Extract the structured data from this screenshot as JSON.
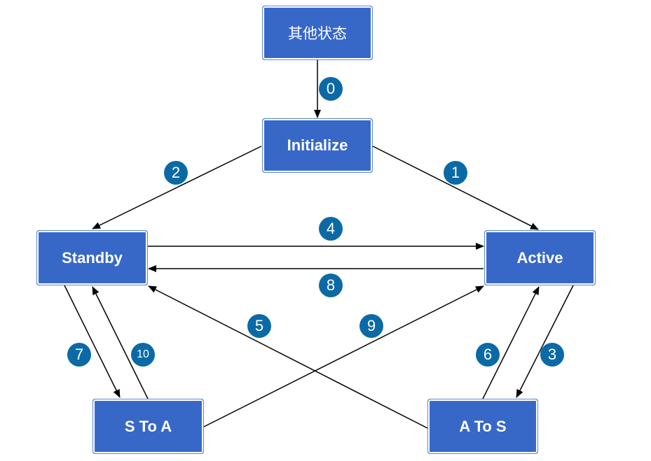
{
  "diagram": {
    "nodes": [
      {
        "id": "other",
        "label": "其他状态"
      },
      {
        "id": "init",
        "label": "Initialize"
      },
      {
        "id": "standby",
        "label": "Standby"
      },
      {
        "id": "active",
        "label": "Active"
      },
      {
        "id": "s2a",
        "label": "S To A"
      },
      {
        "id": "a2s",
        "label": "A To S"
      }
    ],
    "edges": [
      {
        "label": "0",
        "from": "other",
        "to": "init"
      },
      {
        "label": "1",
        "from": "init",
        "to": "active"
      },
      {
        "label": "2",
        "from": "init",
        "to": "standby"
      },
      {
        "label": "3",
        "from": "active",
        "to": "a2s"
      },
      {
        "label": "4",
        "from": "standby",
        "to": "active"
      },
      {
        "label": "5",
        "from": "a2s",
        "to": "standby"
      },
      {
        "label": "6",
        "from": "a2s",
        "to": "active"
      },
      {
        "label": "7",
        "from": "standby",
        "to": "s2a"
      },
      {
        "label": "8",
        "from": "active",
        "to": "standby"
      },
      {
        "label": "9",
        "from": "s2a",
        "to": "active"
      },
      {
        "label": "10",
        "from": "s2a",
        "to": "standby"
      }
    ],
    "colors": {
      "node_fill": "#3768c8",
      "badge_fill": "#0b6aa6",
      "edge": "#000000",
      "text": "#ffffff"
    }
  }
}
